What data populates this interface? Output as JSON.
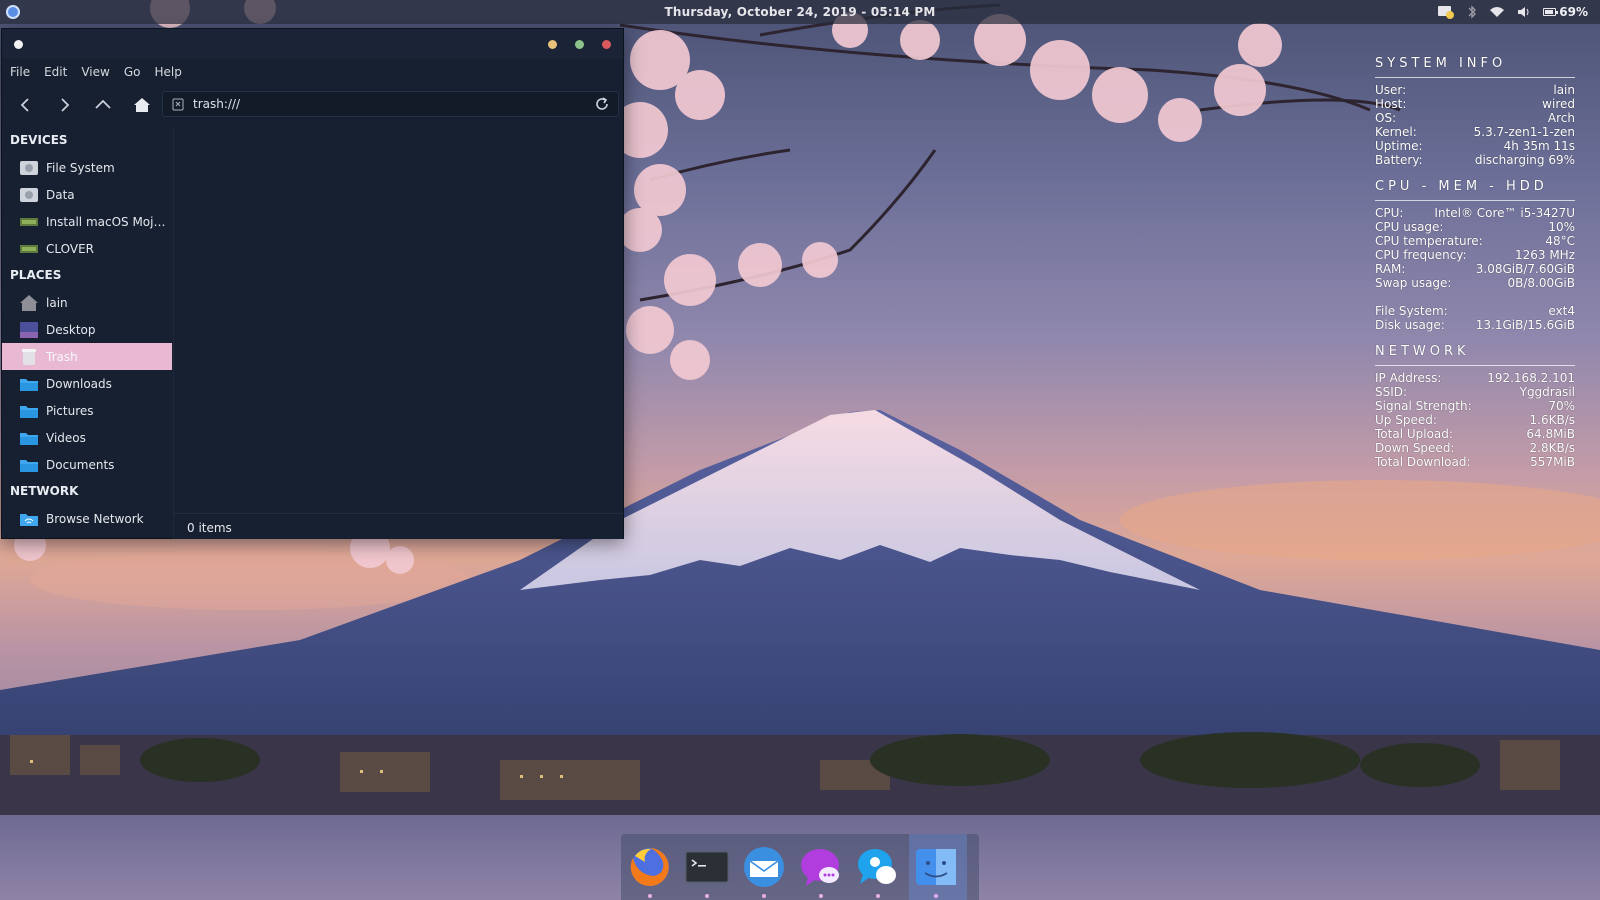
{
  "topbar": {
    "clock": "Thursday, October 24, 2019 - 05:14 PM",
    "battery": "69%",
    "battery_level": 0.69,
    "tray_icons": [
      "notification-icon",
      "bluetooth-icon",
      "wifi-icon",
      "volume-icon",
      "battery-icon"
    ]
  },
  "window": {
    "menu": [
      "File",
      "Edit",
      "View",
      "Go",
      "Help"
    ],
    "address": "trash:///",
    "sections": {
      "devices": "DEVICES",
      "places": "PLACES",
      "network": "NETWORK"
    },
    "devices": [
      {
        "label": "File System",
        "icon": "drive-icon"
      },
      {
        "label": "Data",
        "icon": "drive-icon"
      },
      {
        "label": "Install macOS Mojave",
        "icon": "removable-drive-icon"
      },
      {
        "label": "CLOVER",
        "icon": "removable-drive-icon"
      }
    ],
    "places": [
      {
        "label": "lain",
        "icon": "home-icon"
      },
      {
        "label": "Desktop",
        "icon": "desktop-icon"
      },
      {
        "label": "Trash",
        "icon": "trash-icon",
        "active": true
      },
      {
        "label": "Downloads",
        "icon": "folder-icon"
      },
      {
        "label": "Pictures",
        "icon": "folder-icon"
      },
      {
        "label": "Videos",
        "icon": "folder-icon"
      },
      {
        "label": "Documents",
        "icon": "folder-icon"
      }
    ],
    "network": [
      {
        "label": "Browse Network",
        "icon": "network-icon"
      }
    ],
    "status": "0 items"
  },
  "conky": {
    "system_info": {
      "title": "SYSTEM INFO",
      "rows": [
        {
          "k": "User:",
          "v": "lain"
        },
        {
          "k": "Host:",
          "v": "wired"
        },
        {
          "k": "OS:",
          "v": "Arch"
        },
        {
          "k": "Kernel:",
          "v": "5.3.7-zen1-1-zen"
        },
        {
          "k": "Uptime:",
          "v": "4h 35m 11s"
        },
        {
          "k": "Battery:",
          "v": "discharging 69%"
        }
      ]
    },
    "cpu_mem_hdd": {
      "title": "CPU - MEM - HDD",
      "rows": [
        {
          "k": "CPU:",
          "v": "Intel® Core™ i5-3427U"
        },
        {
          "k": "CPU usage:",
          "v": "10%"
        },
        {
          "k": "CPU temperature:",
          "v": "48°C"
        },
        {
          "k": "CPU frequency:",
          "v": "1263 MHz"
        },
        {
          "k": "RAM:",
          "v": "3.08GiB/7.60GiB"
        },
        {
          "k": "Swap usage:",
          "v": "0B/8.00GiB"
        }
      ],
      "rows2": [
        {
          "k": "File System:",
          "v": "ext4"
        },
        {
          "k": "Disk usage:",
          "v": "13.1GiB/15.6GiB"
        }
      ]
    },
    "network": {
      "title": "NETWORK",
      "rows": [
        {
          "k": "IP Address:",
          "v": "192.168.2.101"
        },
        {
          "k": "SSID:",
          "v": "Yggdrasil"
        },
        {
          "k": "Signal Strength:",
          "v": "70%"
        },
        {
          "k": "Up Speed:",
          "v": "1.6KB/s"
        },
        {
          "k": "Total Upload:",
          "v": "64.8MiB"
        },
        {
          "k": "Down Speed:",
          "v": "2.8KB/s"
        },
        {
          "k": "Total Download:",
          "v": "557MiB"
        }
      ]
    }
  },
  "dock": [
    {
      "name": "firefox-icon"
    },
    {
      "name": "terminal-icon"
    },
    {
      "name": "mail-icon"
    },
    {
      "name": "messenger-icon"
    },
    {
      "name": "chat-icon"
    },
    {
      "name": "finder-icon",
      "active": true
    }
  ],
  "colors": {
    "window_bg": "#172030",
    "selection": "#e9b9d4",
    "folder": "#3ea7ef"
  }
}
